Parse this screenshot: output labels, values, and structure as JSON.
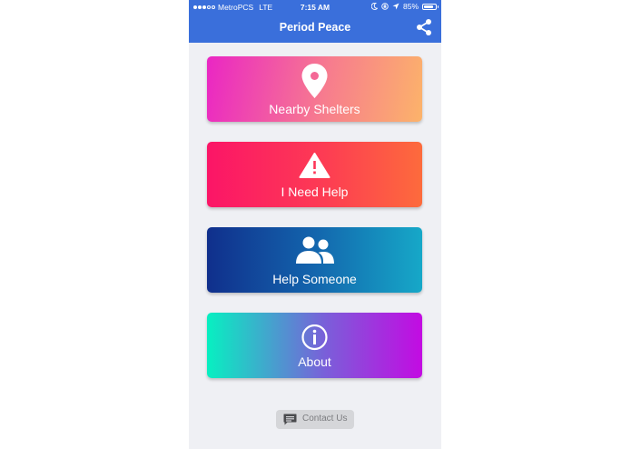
{
  "status_bar": {
    "carrier": "MetroPCS",
    "network": "LTE",
    "time": "7:15 AM",
    "battery": "85%",
    "battery_level": 0.85
  },
  "header": {
    "title": "Period Peace",
    "background": "#3a6fdb"
  },
  "menu": [
    {
      "label": "Nearby Shelters",
      "icon": "location-pin-icon"
    },
    {
      "label": "I Need Help",
      "icon": "warning-icon"
    },
    {
      "label": "Help Someone",
      "icon": "people-icon"
    },
    {
      "label": "About",
      "icon": "info-icon"
    }
  ],
  "contact": {
    "label": "Contact Us",
    "icon": "chat-icon"
  }
}
